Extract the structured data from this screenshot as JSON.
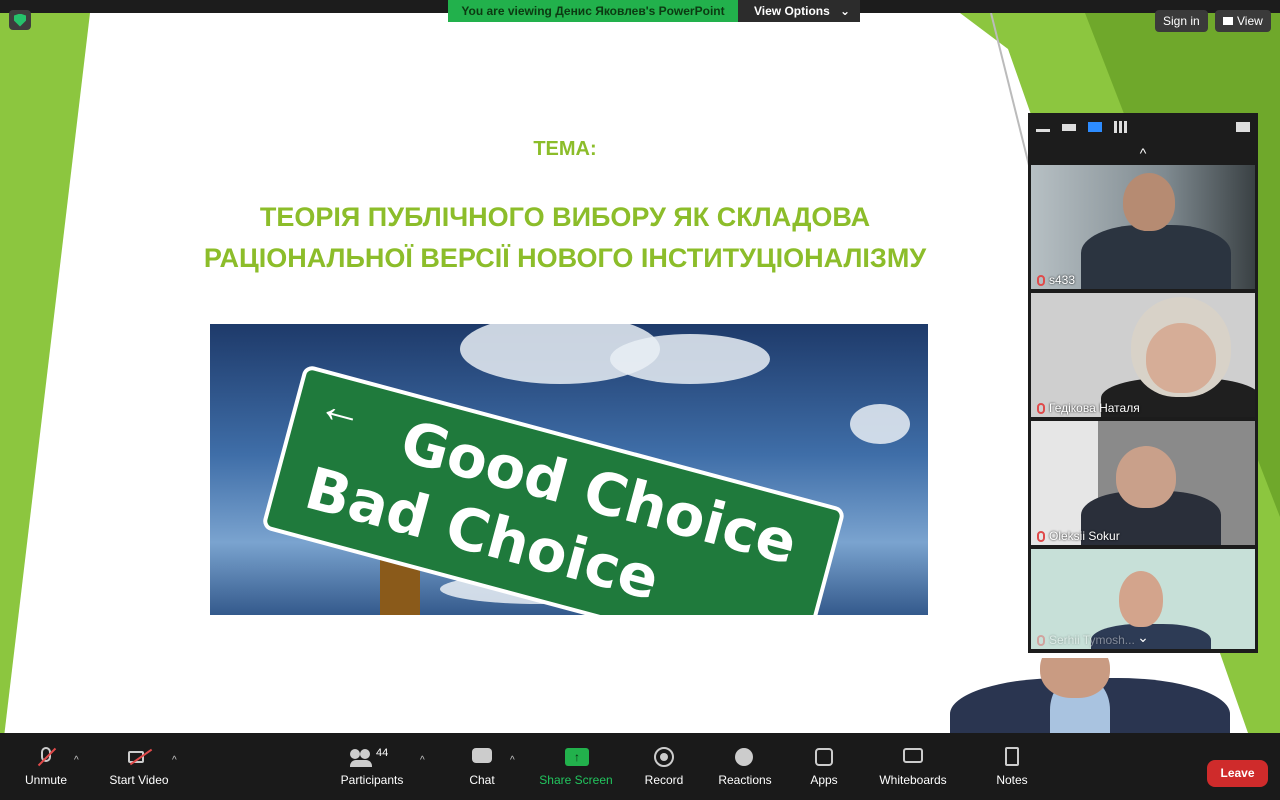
{
  "banner": {
    "viewing_text": "You are viewing Денис Яковлев's PowerPoint",
    "view_options": "View Options",
    "chevron": "⌄"
  },
  "top_right": {
    "sign_in": "Sign in",
    "view": "View"
  },
  "slide": {
    "label": "ТЕМА:",
    "title_line1": "ТЕОРІЯ ПУБЛІЧНОГО ВИБОРУ ЯК СКЛАДОВА",
    "title_line2": "РАЦІОНАЛЬНОЇ ВЕРСІЇ НОВОГО ІНСТИТУЦІОНАЛІЗМУ",
    "image_sign": {
      "line1": "Good Choice",
      "line2": "Bad Choice"
    }
  },
  "gallery": {
    "up_arrow": "^",
    "down_arrow": "⌄",
    "participants": [
      {
        "name": "s433",
        "muted": true
      },
      {
        "name": "Гедікова Наталя",
        "muted": true
      },
      {
        "name": "Oleksii Sokur",
        "muted": true
      },
      {
        "name": "Serhii Tymosh...",
        "muted": true
      }
    ]
  },
  "toolbar": {
    "unmute": "Unmute",
    "start_video": "Start Video",
    "participants": "Participants",
    "participants_count": "44",
    "chat": "Chat",
    "share_screen": "Share Screen",
    "record": "Record",
    "reactions": "Reactions",
    "apps": "Apps",
    "whiteboards": "Whiteboards",
    "notes": "Notes",
    "leave": "Leave",
    "caret": "^"
  },
  "colors": {
    "slide_green": "#8cbd2a",
    "share_green": "#22b14c",
    "leave_red": "#cf2b2b",
    "active_blue": "#2d8cff"
  }
}
